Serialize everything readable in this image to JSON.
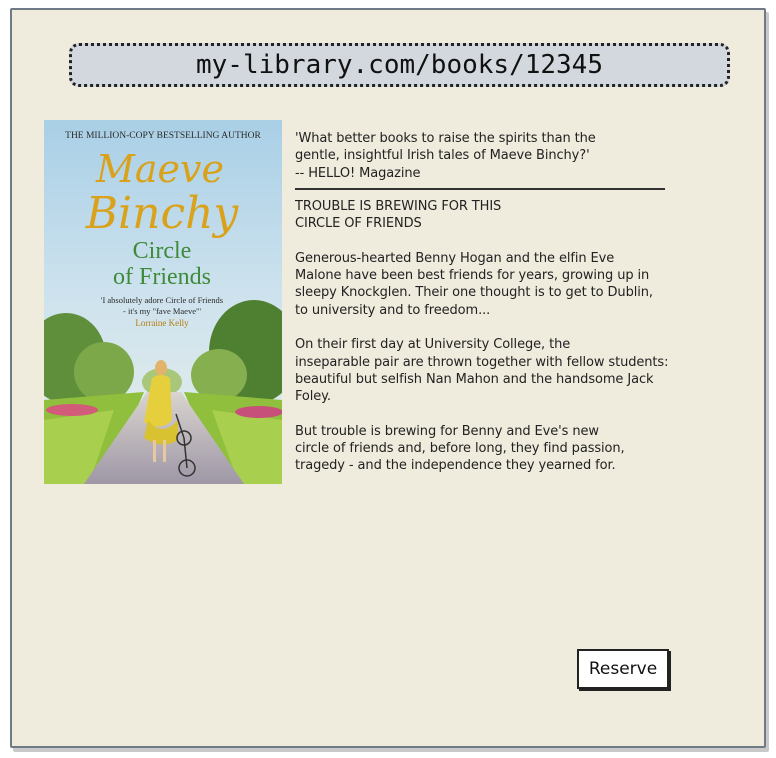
{
  "browser": {
    "url": "my-library.com/books/12345"
  },
  "book": {
    "cover": {
      "tagline": "THE MILLION-COPY BESTSELLING AUTHOR",
      "author_first": "Maeve",
      "author_last": "Binchy",
      "title_line1": "Circle",
      "title_line2": "of Friends",
      "quote_line1": "'I absolutely adore Circle of Friends",
      "quote_line2": "- it's my \"fave Maeve\"'",
      "quote_source": "Lorraine Kelly"
    },
    "review_line1": "'What better books to raise the spirits than the",
    "review_line2": "gentle, insightful Irish tales of Maeve Binchy?'",
    "review_source": "-- HELLO! Magazine",
    "headline_line1": "TROUBLE IS BREWING FOR THIS",
    "headline_line2": "CIRCLE OF FRIENDS",
    "para1_line1": "Generous-hearted Benny Hogan and the elfin Eve",
    "para1_line2": "Malone have been best friends for years, growing up in",
    "para1_line3": "sleepy Knockglen. Their one thought is to get to Dublin,",
    "para1_line4": "to university and to freedom...",
    "para2_line1": "On their first day at University College, the",
    "para2_line2": "inseparable pair are thrown together with fellow students:",
    "para2_line3": "beautiful but selfish Nan Mahon and the handsome Jack",
    "para2_line4": "Foley.",
    "para3_line1": "But trouble is brewing for Benny and Eve's new",
    "para3_line2": "circle of friends and, before long, they find passion,",
    "para3_line3": "tragedy - and the independence they yearned for."
  },
  "actions": {
    "reserve_label": "Reserve"
  },
  "colors": {
    "page_bg": "#efebdd",
    "address_bg": "#d3d8de",
    "cover_title_gold": "#d9a21a",
    "cover_subtitle_green": "#3e8a3a"
  }
}
